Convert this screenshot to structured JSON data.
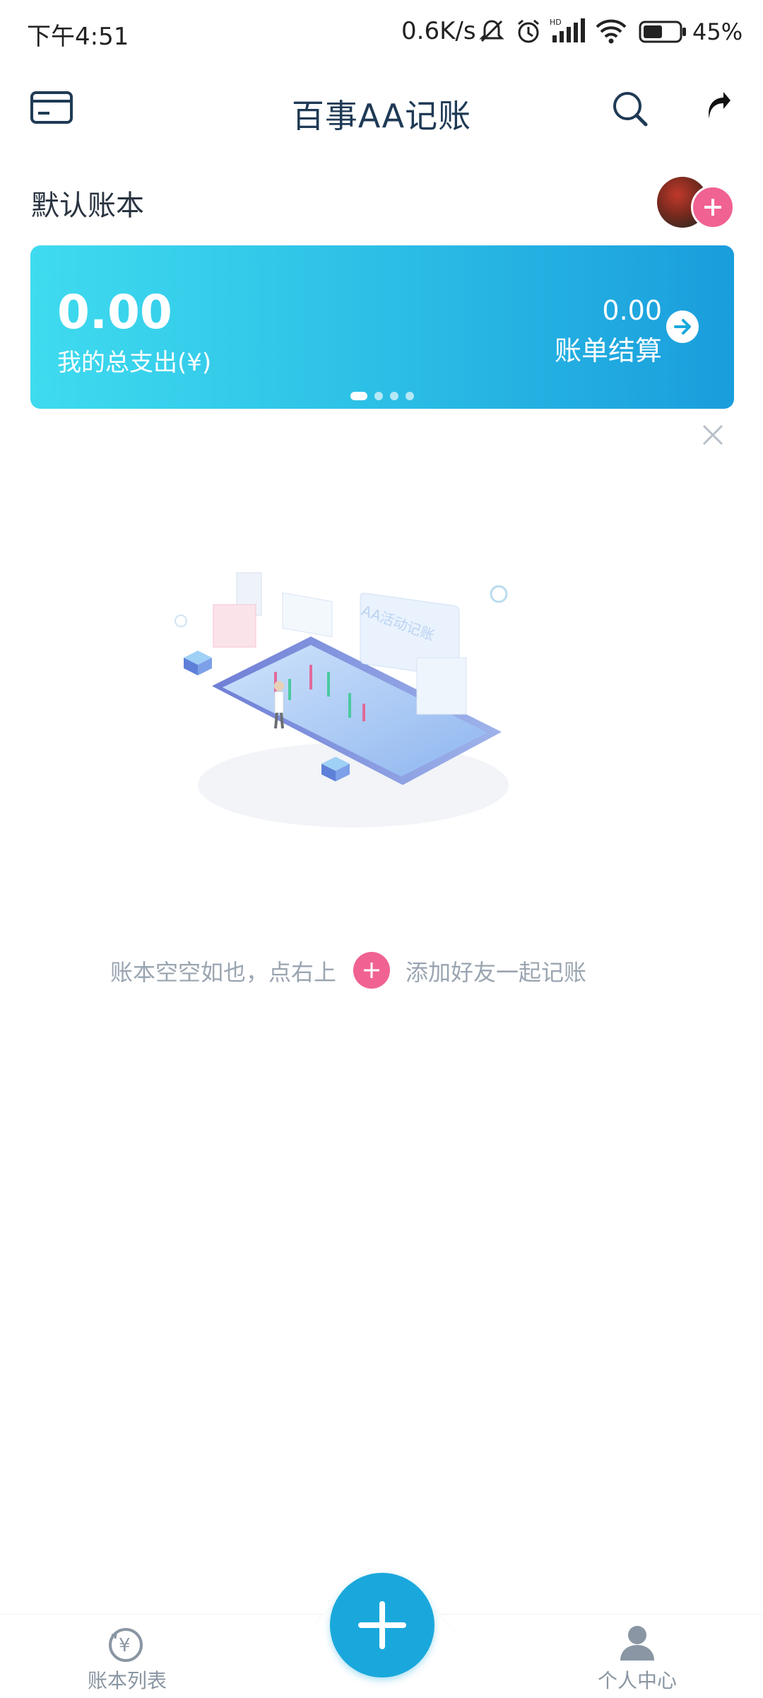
{
  "status_bar": {
    "time": "下午4:51",
    "net_speed": "0.6K/s",
    "battery": "45%",
    "icons": [
      "mute-bell-icon",
      "alarm-icon",
      "hd-signal-icon",
      "wifi-icon",
      "battery-icon"
    ]
  },
  "header": {
    "title": "百事AA记账",
    "left_icon": "card-icon",
    "right_icons": [
      "search-icon",
      "share-icon"
    ]
  },
  "ledger": {
    "name": "默认账本",
    "members_icon": "avatar"
  },
  "summary": {
    "total_amount": "0.00",
    "total_label": "我的总支出(¥)",
    "settle_amount": "0.00",
    "settle_label": "账单结算",
    "page_count": 4,
    "active_page": 1
  },
  "empty_state": {
    "hint_left": "账本空空如也，点右上",
    "hint_right": "添加好友一起记账",
    "illustration_text": "AA活动记账"
  },
  "bottom_nav": {
    "left_label": "账本列表",
    "right_label": "个人中心"
  },
  "colors": {
    "accent": "#1aa8dc",
    "pink": "#f06292",
    "title": "#1f3a55"
  }
}
